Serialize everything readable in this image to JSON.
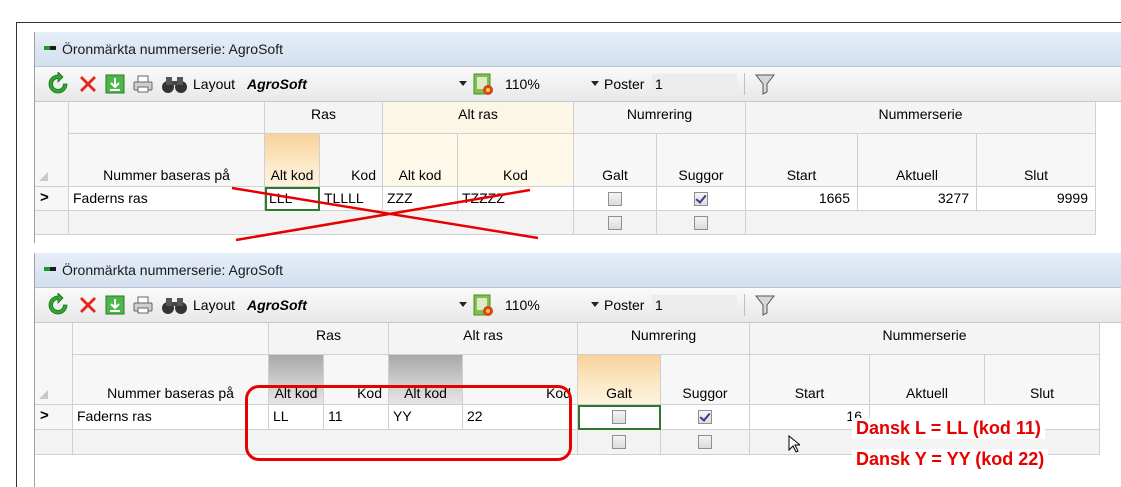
{
  "windows": [
    {
      "title": "Öronmärkta nummerserie: AgroSoft",
      "toolbar": {
        "layout_label": "Layout",
        "layout_value": "AgroSoft",
        "zoom": "110%",
        "poster_label": "Poster",
        "poster_value": "1"
      },
      "groups": {
        "ras": "Ras",
        "alt_ras": "Alt ras",
        "numrering": "Numrering",
        "nummerserie": "Nummerserie"
      },
      "columns": {
        "nummer_baseras": "Nummer baseras på",
        "ras_alt_kod": "Alt kod",
        "ras_kod": "Kod",
        "alt_alt_kod": "Alt kod",
        "alt_kod": "Kod",
        "galt": "Galt",
        "suggor": "Suggor",
        "start": "Start",
        "aktuell": "Aktuell",
        "slut": "Slut"
      },
      "row": {
        "marker": ">",
        "nummer_baseras": "Faderns ras",
        "ras_alt_kod": "LLL",
        "ras_kod": "TLLLL",
        "alt_alt_kod": "ZZZ",
        "alt_kod": "TZZZZ",
        "galt": false,
        "suggor": true,
        "start": "1665",
        "aktuell": "3277",
        "slut": "9999"
      }
    },
    {
      "title": "Öronmärkta nummerserie: AgroSoft",
      "toolbar": {
        "layout_label": "Layout",
        "layout_value": "AgroSoft",
        "zoom": "110%",
        "poster_label": "Poster",
        "poster_value": "1"
      },
      "groups": {
        "ras": "Ras",
        "alt_ras": "Alt ras",
        "numrering": "Numrering",
        "nummerserie": "Nummerserie"
      },
      "columns": {
        "nummer_baseras": "Nummer baseras på",
        "ras_alt_kod": "Alt kod",
        "ras_kod": "Kod",
        "alt_alt_kod": "Alt kod",
        "alt_kod": "Kod",
        "galt": "Galt",
        "suggor": "Suggor",
        "start": "Start",
        "aktuell": "Aktuell",
        "slut": "Slut"
      },
      "row": {
        "marker": ">",
        "nummer_baseras": "Faderns ras",
        "ras_alt_kod": "LL",
        "ras_kod": "11",
        "alt_alt_kod": "YY",
        "alt_kod": "22",
        "galt": false,
        "suggor": true,
        "start": "16"
      }
    }
  ],
  "annotations": {
    "note1": "Dansk L =  LL (kod 11)",
    "note2": "Dansk Y = YY (kod 22)",
    "color": "#e60000"
  },
  "icons": [
    "refresh-icon",
    "delete-icon",
    "save-icon",
    "print-icon",
    "binoculars-icon",
    "report-icon",
    "filter-icon"
  ]
}
